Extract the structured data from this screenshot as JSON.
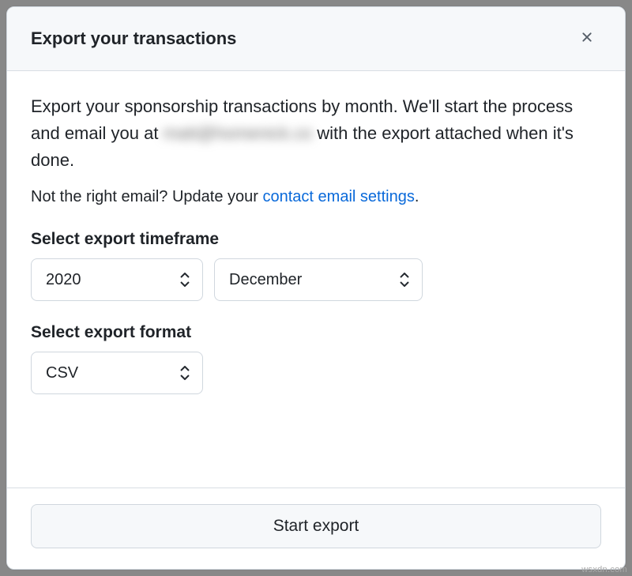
{
  "header": {
    "title": "Export your transactions"
  },
  "body": {
    "description_prefix": "Export your sponsorship transactions by month. We'll start the process and email you at ",
    "redacted_email_placeholder": "matt@homenick.co",
    "description_suffix": " with the export attached when it's done.",
    "email_hint_prefix": "Not the right email? Update your ",
    "email_link_text": "contact email settings",
    "email_hint_suffix": "."
  },
  "timeframe": {
    "label": "Select export timeframe",
    "year_value": "2020",
    "month_value": "December"
  },
  "format": {
    "label": "Select export format",
    "value": "CSV"
  },
  "footer": {
    "start_button": "Start export"
  },
  "watermark": "wsxdn.com"
}
